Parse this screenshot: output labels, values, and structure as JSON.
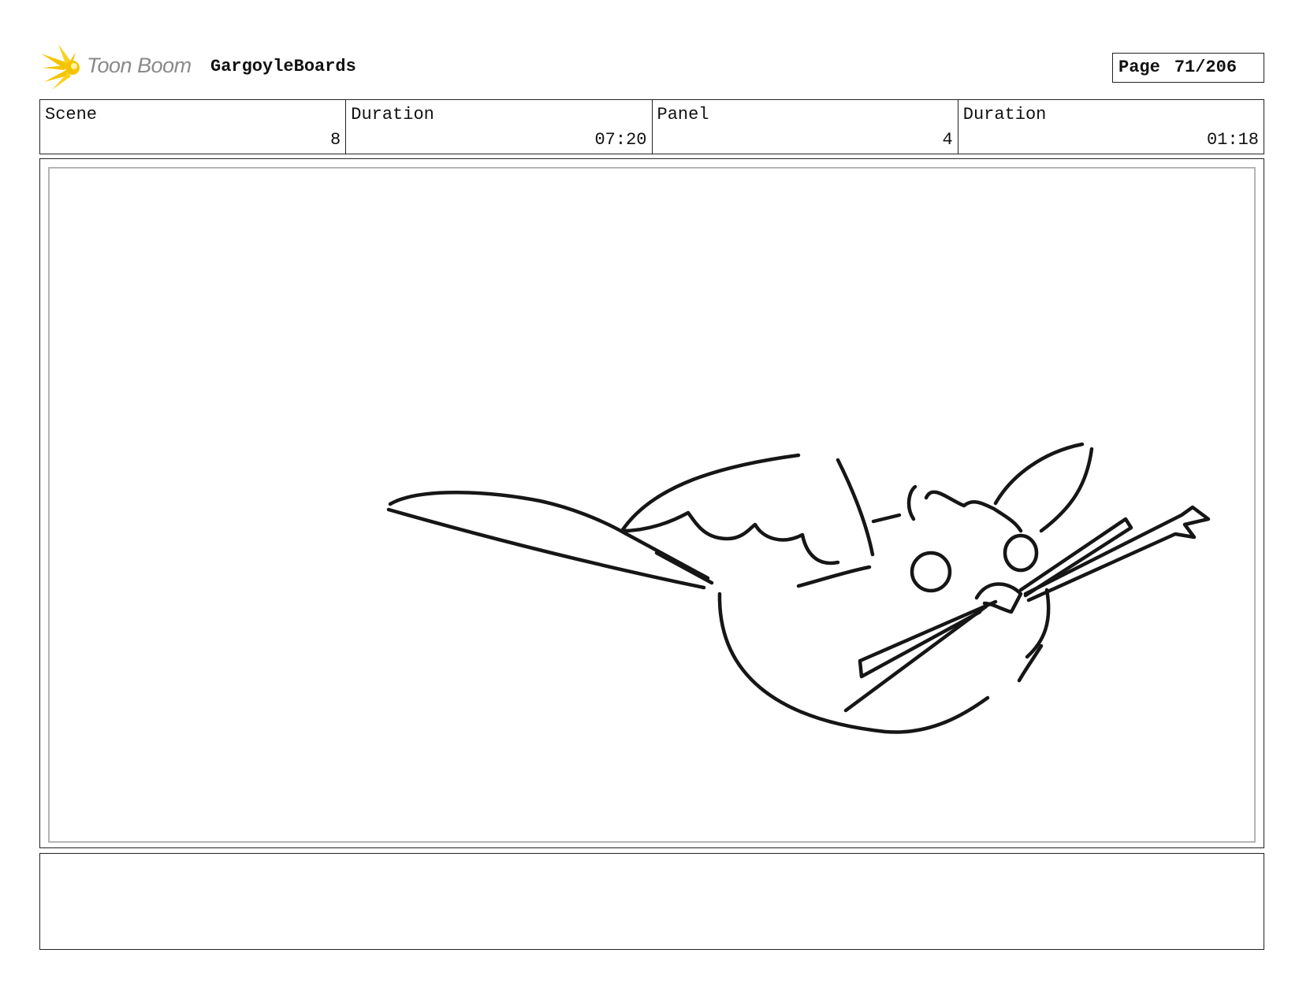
{
  "header": {
    "logo_text": "Toon Boom",
    "project_title": "GargoyleBoards",
    "page_label": "Page",
    "page_number": "71/206"
  },
  "info": {
    "scene_label": "Scene",
    "scene_value": "8",
    "scene_duration_label": "Duration",
    "scene_duration_value": "07:20",
    "panel_label": "Panel",
    "panel_value": "4",
    "panel_duration_label": "Duration",
    "panel_duration_value": "01:18"
  },
  "colors": {
    "logo_star": "#f5c400",
    "logo_text": "#8a8a8a",
    "border": "#222222",
    "panel_inner_border": "#b5b5b5"
  },
  "icons": {
    "logo": "toon-boom-star-icon"
  },
  "notes": {
    "text": ""
  }
}
